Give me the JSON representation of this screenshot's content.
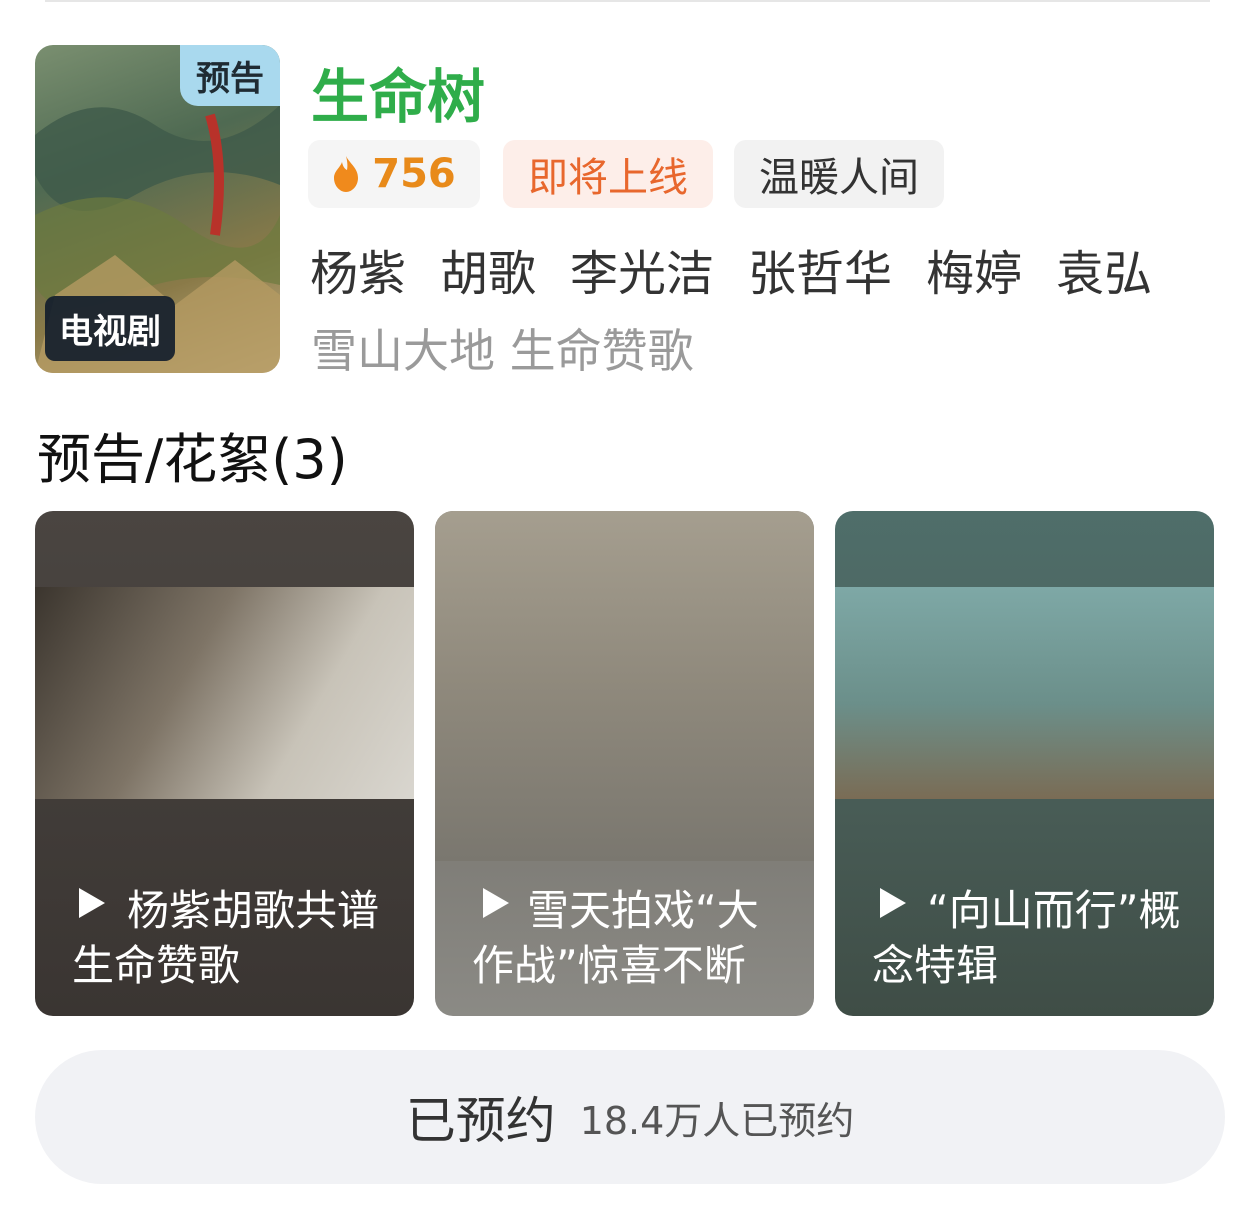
{
  "show": {
    "title": "生命树",
    "poster_badge": "预告",
    "type_badge": "电视剧",
    "heat": "756",
    "status": "即将上线",
    "tag": "温暖人间",
    "cast": [
      "杨紫",
      "胡歌",
      "李光洁",
      "张哲华",
      "梅婷",
      "袁弘"
    ],
    "slogan": "雪山大地 生命赞歌",
    "colors": {
      "title": "#2fad4a",
      "status": "#e8672d",
      "heat": "#e88a1a"
    }
  },
  "videos": {
    "section_title": "预告/花絮(3)",
    "items": [
      {
        "caption": "杨紫胡歌共谱生命赞歌"
      },
      {
        "caption": "雪天拍戏“大作战”惊喜不断"
      },
      {
        "caption": "“向山而行”概念特辑"
      }
    ]
  },
  "reserve": {
    "label": "已预约",
    "count": "18.4万人已预约"
  }
}
